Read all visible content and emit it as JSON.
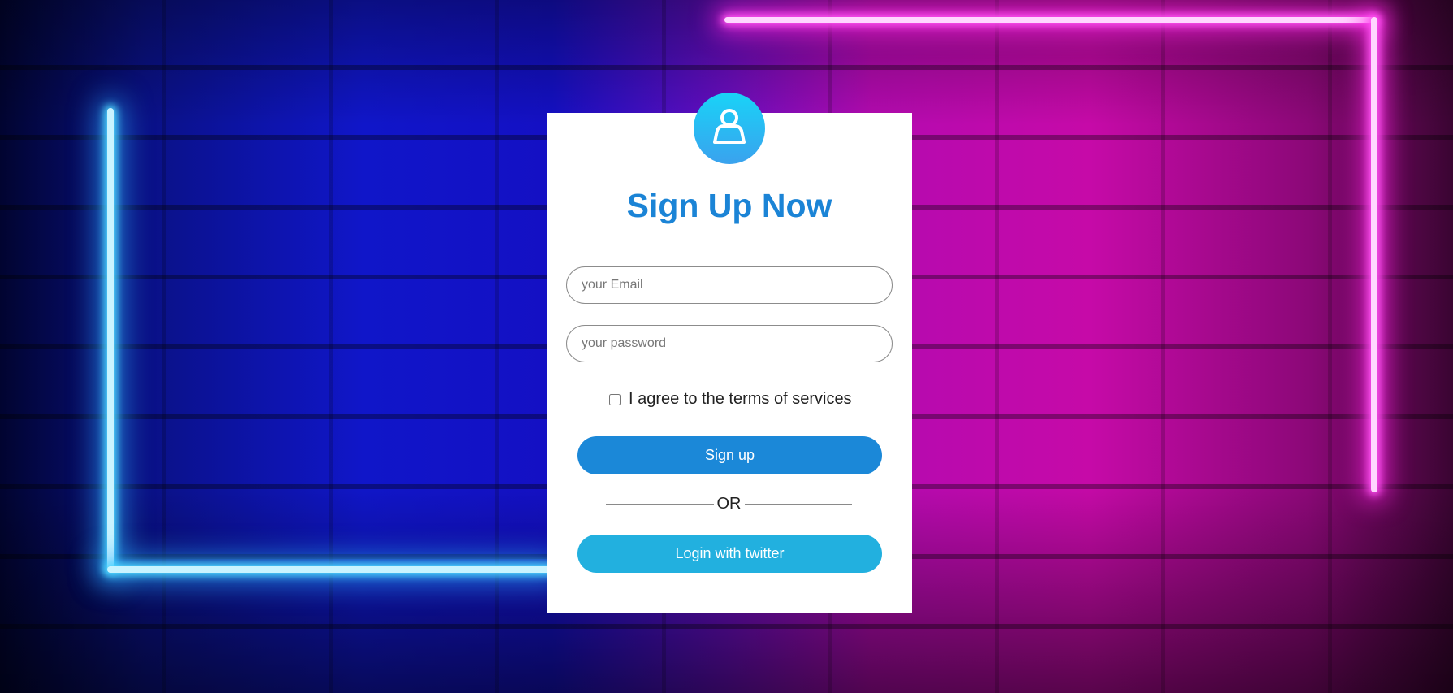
{
  "form": {
    "title": "Sign Up Now",
    "email_placeholder": "your Email",
    "password_placeholder": "your password",
    "agree_label": "I agree to the terms of services",
    "signup_label": "Sign up",
    "or_label": "OR",
    "twitter_label": "Login with twitter"
  },
  "icons": {
    "avatar": "user-icon"
  },
  "colors": {
    "title": "#1b84d6",
    "signup_button": "#1b88d8",
    "twitter_button": "#22b0df",
    "avatar_top": "#19d3f7",
    "avatar_bottom": "#3aa2ee"
  }
}
